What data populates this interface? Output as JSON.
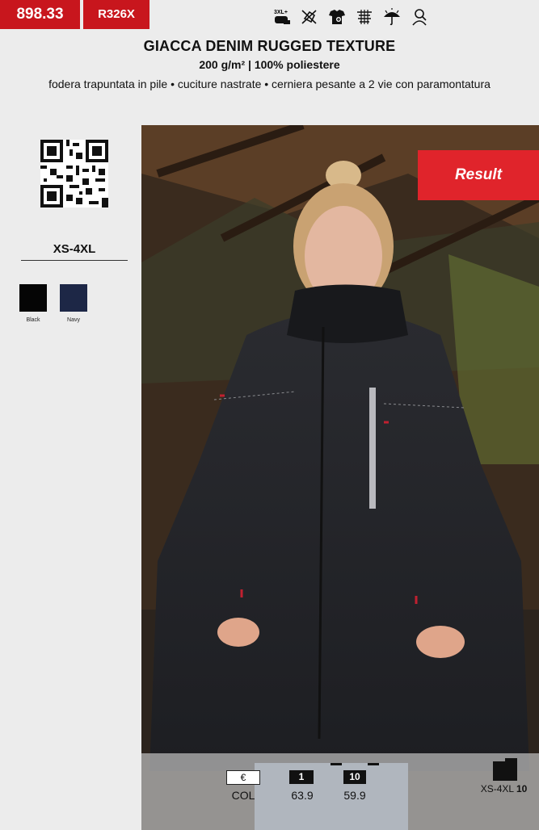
{
  "header": {
    "code": "898.33",
    "ref": "R326X",
    "icons": [
      "size-3xl-icon",
      "no-iron-icon",
      "shirt-care-icon",
      "lining-icon",
      "umbrella-icon",
      "person-fit-icon"
    ],
    "icon_3xl_text": "3XL+"
  },
  "product": {
    "title": "GIACCA DENIM RUGGED TEXTURE",
    "subtitle": "200 g/m² | 100% poliestere",
    "description": "fodera trapuntata in pile • cuciture nastrate • cerniera pesante a 2 vie con paramontatura"
  },
  "sidebar": {
    "sizes": "XS-4XL",
    "colors": [
      {
        "name": "Black",
        "hex": "#050505"
      },
      {
        "name": "Navy",
        "hex": "#1d2746"
      }
    ]
  },
  "photo": {
    "brand": "Result",
    "brand_color": "#e0242b"
  },
  "pricing": {
    "currency": "€",
    "col_label": "COL",
    "qty_1": "1",
    "price_1": "63.9",
    "qty_10": "10",
    "price_10": "59.9",
    "box_sizes": "XS-4XL",
    "box_qty": "10"
  },
  "colors": {
    "accent": "#c8161d",
    "background": "#ececec"
  }
}
